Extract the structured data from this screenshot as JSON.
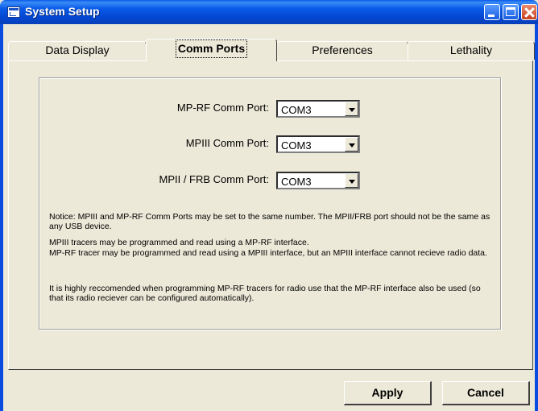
{
  "window": {
    "title": "System Setup",
    "title_bar_color": "#0a5be8",
    "background": "#ece9d8"
  },
  "tabs": [
    {
      "label": "Data Display",
      "active": false
    },
    {
      "label": "Comm Ports",
      "active": true
    },
    {
      "label": "Preferences",
      "active": false
    },
    {
      "label": "Lethality",
      "active": false
    }
  ],
  "ports": [
    {
      "label": "MP-RF Comm Port:",
      "value": "COM3"
    },
    {
      "label": "MPIII Comm Port:",
      "value": "COM3"
    },
    {
      "label": "MPII / FRB Comm Port:",
      "value": "COM3"
    }
  ],
  "notices": {
    "notice1": "Notice:  MPIII and MP-RF Comm Ports may be set to the same number.  The MPII/FRB port should not be the same as any USB device.",
    "notice2_line1": "MPIII tracers may be programmed and read using a MP-RF interface.",
    "notice2_line2": "MP-RF tracer may be programmed and read using a MPIII interface, but an MPIII interface cannot recieve radio data.",
    "notice3": "It is highly reccomended when programming MP-RF tracers for radio use that the MP-RF interface also be used (so that its radio reciever can be configured automatically)."
  },
  "buttons": {
    "apply": "Apply",
    "cancel": "Cancel"
  },
  "icons": [
    "app-window-icon",
    "minimize-icon",
    "maximize-icon",
    "close-icon",
    "dropdown-arrow-icon"
  ]
}
